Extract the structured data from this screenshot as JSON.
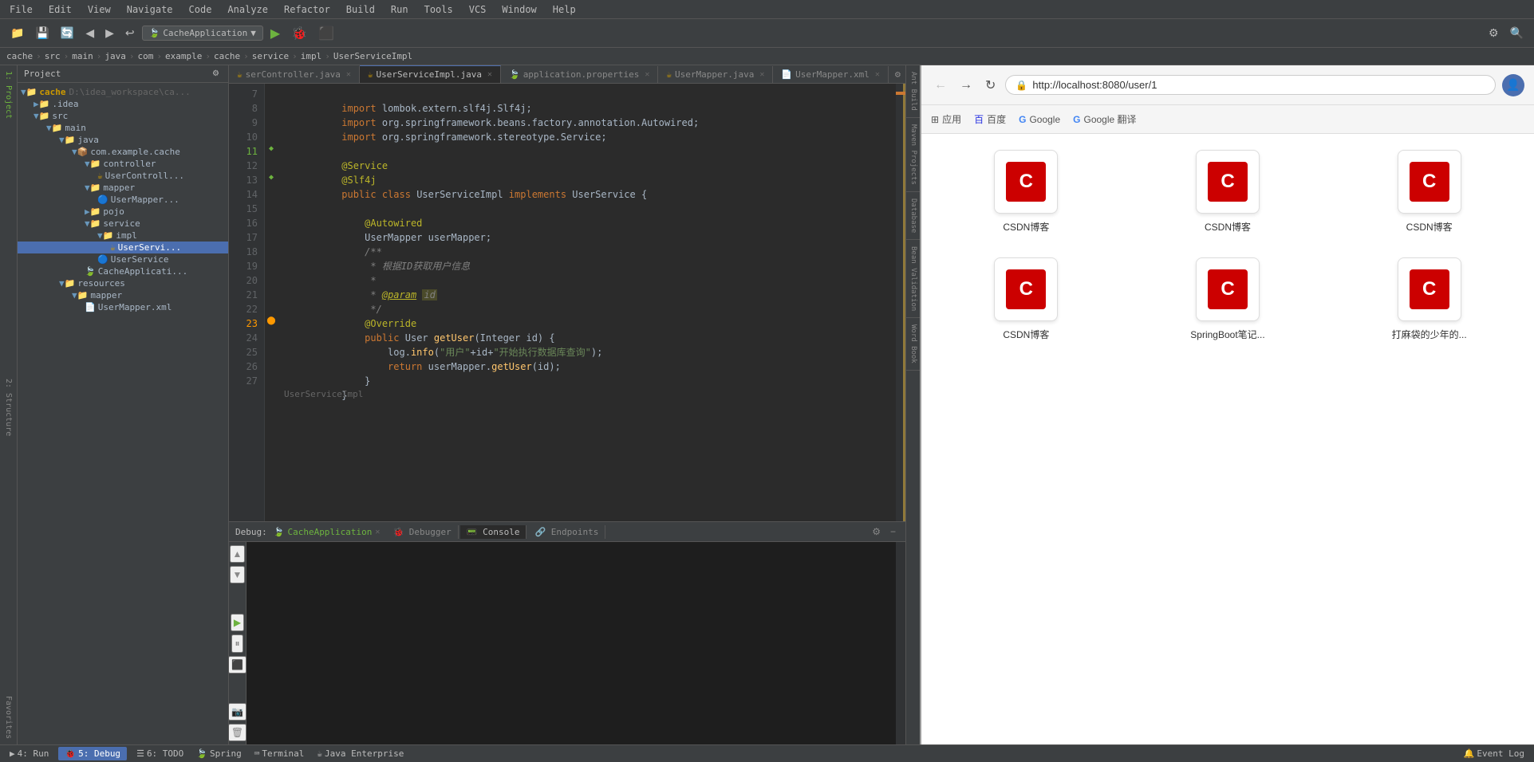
{
  "menuBar": {
    "items": [
      "File",
      "Edit",
      "View",
      "Navigate",
      "Code",
      "Analyze",
      "Refactor",
      "Build",
      "Run",
      "Tools",
      "VCS",
      "Window",
      "Help"
    ]
  },
  "toolbar": {
    "project": "CacheApplication",
    "run_label": "▶",
    "debug_label": "🐞"
  },
  "breadcrumb": {
    "items": [
      "cache",
      "src",
      "main",
      "java",
      "com",
      "example",
      "cache",
      "service",
      "impl",
      "UserServiceImpl"
    ]
  },
  "projectPanel": {
    "title": "Project",
    "rootPath": "D:\\idea_workspace\\ca...",
    "tree": [
      {
        "id": "cache",
        "label": "cache",
        "type": "folder",
        "depth": 0,
        "expanded": true
      },
      {
        "id": "idea",
        "label": ".idea",
        "type": "folder",
        "depth": 1,
        "expanded": false
      },
      {
        "id": "src",
        "label": "src",
        "type": "folder",
        "depth": 1,
        "expanded": true
      },
      {
        "id": "main",
        "label": "main",
        "type": "folder",
        "depth": 2,
        "expanded": true
      },
      {
        "id": "java",
        "label": "java",
        "type": "folder",
        "depth": 3,
        "expanded": true
      },
      {
        "id": "com_example_cache",
        "label": "com.example.cache",
        "type": "package",
        "depth": 4,
        "expanded": true
      },
      {
        "id": "controller",
        "label": "controller",
        "type": "folder",
        "depth": 5,
        "expanded": true
      },
      {
        "id": "UserController",
        "label": "UserControll...",
        "type": "java",
        "depth": 6,
        "expanded": false
      },
      {
        "id": "mapper",
        "label": "mapper",
        "type": "folder",
        "depth": 5,
        "expanded": true
      },
      {
        "id": "UserMapper_if",
        "label": "UserMapper...",
        "type": "java-interface",
        "depth": 6,
        "expanded": false
      },
      {
        "id": "pojo",
        "label": "pojo",
        "type": "folder",
        "depth": 5,
        "expanded": false
      },
      {
        "id": "service",
        "label": "service",
        "type": "folder",
        "depth": 5,
        "expanded": true
      },
      {
        "id": "impl",
        "label": "impl",
        "type": "folder",
        "depth": 6,
        "expanded": true
      },
      {
        "id": "UserServiceImpl_file",
        "label": "UserServi...",
        "type": "java-selected",
        "depth": 7,
        "expanded": false
      },
      {
        "id": "UserService_if",
        "label": "UserService",
        "type": "java-interface",
        "depth": 6,
        "expanded": false
      },
      {
        "id": "CacheApplication",
        "label": "CacheApplicati...",
        "type": "app",
        "depth": 5,
        "expanded": false
      },
      {
        "id": "resources",
        "label": "resources",
        "type": "folder",
        "depth": 3,
        "expanded": true
      },
      {
        "id": "mapper_res",
        "label": "mapper",
        "type": "folder",
        "depth": 4,
        "expanded": true
      },
      {
        "id": "UserMapper_xml",
        "label": "UserMapper.xml",
        "type": "xml",
        "depth": 5,
        "expanded": false
      }
    ]
  },
  "editorTabs": [
    {
      "id": "serController",
      "label": "serController.java",
      "active": false,
      "modified": false
    },
    {
      "id": "UserServiceImpl",
      "label": "UserServiceImpl.java",
      "active": true,
      "modified": false
    },
    {
      "id": "application",
      "label": "application.properties",
      "active": false,
      "modified": false
    },
    {
      "id": "UserMapper_java",
      "label": "UserMapper.java",
      "active": false,
      "modified": false
    },
    {
      "id": "UserMapper_xml",
      "label": "UserMapper.xml",
      "active": false,
      "modified": false
    }
  ],
  "codeLines": [
    {
      "num": 7,
      "content": "import lombok.extern.slf4j.Slf4j;",
      "type": "import"
    },
    {
      "num": 8,
      "content": "import org.springframework.beans.factory.annotation.Autowired;",
      "type": "import"
    },
    {
      "num": 9,
      "content": "import org.springframework.stereotype.Service;",
      "type": "import"
    },
    {
      "num": 10,
      "content": "",
      "type": "blank"
    },
    {
      "num": 11,
      "content": "@Service",
      "type": "annotation"
    },
    {
      "num": 12,
      "content": "@Slf4j",
      "type": "annotation"
    },
    {
      "num": 13,
      "content": "public class UserServiceImpl implements UserService {",
      "type": "code"
    },
    {
      "num": 14,
      "content": "",
      "type": "blank"
    },
    {
      "num": 15,
      "content": "    @Autowired",
      "type": "annotation"
    },
    {
      "num": 16,
      "content": "    UserMapper userMapper;",
      "type": "code"
    },
    {
      "num": 17,
      "content": "    /**",
      "type": "comment"
    },
    {
      "num": 18,
      "content": "     * 根据ID获取用户信息",
      "type": "comment"
    },
    {
      "num": 19,
      "content": "     *",
      "type": "comment"
    },
    {
      "num": 20,
      "content": "     * @param id",
      "type": "comment"
    },
    {
      "num": 21,
      "content": "     */",
      "type": "comment"
    },
    {
      "num": 22,
      "content": "    @Override",
      "type": "annotation"
    },
    {
      "num": 23,
      "content": "    public User getUser(Integer id) {",
      "type": "code"
    },
    {
      "num": 24,
      "content": "        log.info(\"用户\"+id+\"开始执行数据库查询\");",
      "type": "code"
    },
    {
      "num": 25,
      "content": "        return userMapper.getUser(id);",
      "type": "code"
    },
    {
      "num": 26,
      "content": "    }",
      "type": "code"
    },
    {
      "num": 27,
      "content": "}",
      "type": "code"
    }
  ],
  "filename": "UserServiceImpl",
  "debugPanel": {
    "label": "Debug:",
    "app": "CacheApplication",
    "tabs": [
      "Debugger",
      "Console",
      "Endpoints"
    ],
    "activeTab": "Console"
  },
  "statusBar": {
    "items": [
      "4: Run",
      "5: Debug",
      "6: TODO",
      "Spring",
      "Terminal",
      "Java Enterprise",
      "Event Log"
    ]
  },
  "browser": {
    "url": "http://localhost:8080/user/1",
    "bookmarks": [
      "应用",
      "百度",
      "Google",
      "Google 翻译"
    ],
    "cards": [
      {
        "label": "CSDN博客",
        "logo": "C"
      },
      {
        "label": "CSDN博客",
        "logo": "C"
      },
      {
        "label": "CSDN博客",
        "logo": "C"
      },
      {
        "label": "CSDN博客",
        "logo": "C"
      },
      {
        "label": "SpringBoot笔记...",
        "logo": "C"
      },
      {
        "label": "打麻袋的少年的...",
        "logo": "C"
      }
    ]
  },
  "rightTabs": [
    "Ant Build",
    "Maven Projects",
    "Database",
    "Bean Validation",
    "Word Book"
  ]
}
